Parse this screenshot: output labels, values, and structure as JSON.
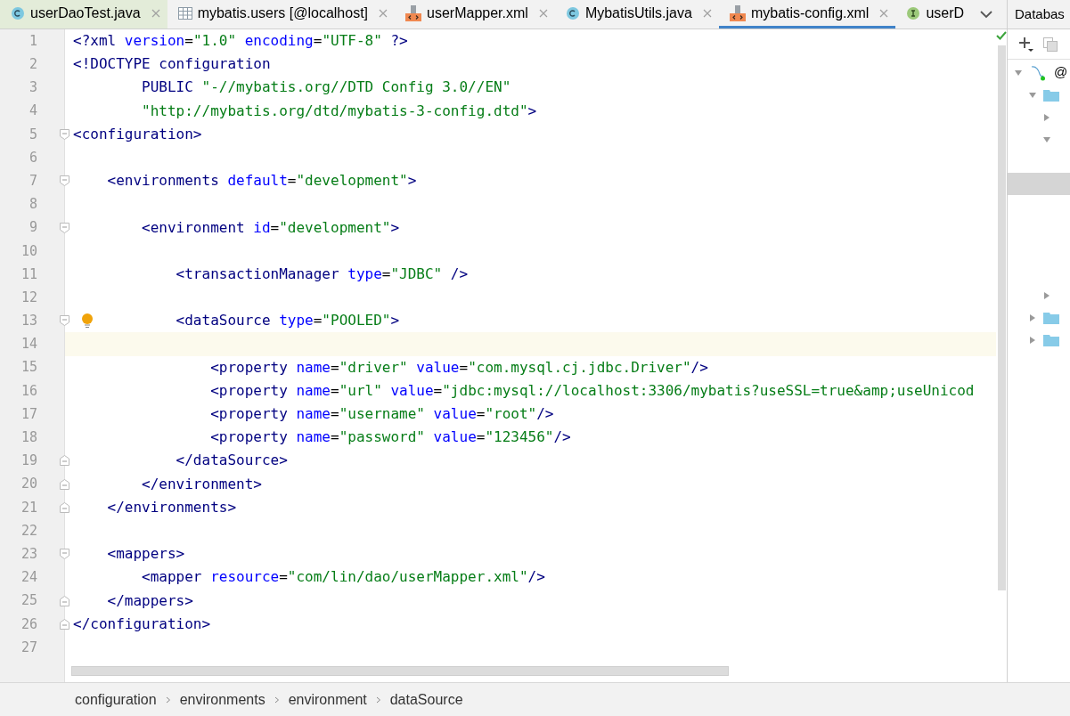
{
  "tabs": [
    {
      "kind": "class",
      "label": "userDaoTest.java",
      "selected": false,
      "closable": true,
      "color": "#e3ecd9"
    },
    {
      "kind": "table",
      "label": "mybatis.users [@localhost]",
      "selected": false,
      "closable": true,
      "color": "#f2f2f2"
    },
    {
      "kind": "xml",
      "label": "userMapper.xml",
      "selected": false,
      "closable": true,
      "color": "#f2f2f2"
    },
    {
      "kind": "class",
      "label": "MybatisUtils.java",
      "selected": false,
      "closable": true,
      "color": "#f2f2f2"
    },
    {
      "kind": "xml",
      "label": "mybatis-config.xml",
      "selected": true,
      "closable": true,
      "color": "#f2f2f2"
    },
    {
      "kind": "interface",
      "label": "userD",
      "selected": false,
      "closable": false,
      "color": "#f2f2f2"
    }
  ],
  "panel": {
    "title": "Databas",
    "tree": [
      {
        "kind": "connection",
        "label": "@",
        "expanded": true,
        "children": [
          {
            "kind": "folder",
            "expanded": true,
            "children": [
              {
                "kind": "node",
                "expanded": false
              },
              {
                "kind": "node",
                "expanded": true,
                "children": [
                  {
                    "kind": "row",
                    "selected": false
                  },
                  {
                    "kind": "row",
                    "selected": true
                  },
                  {
                    "kind": "row",
                    "selected": false
                  },
                  {
                    "kind": "row",
                    "selected": false
                  },
                  {
                    "kind": "row",
                    "selected": false
                  },
                  {
                    "kind": "row",
                    "selected": false
                  }
                ]
              },
              {
                "kind": "node",
                "expanded": false
              }
            ]
          },
          {
            "kind": "folder",
            "expanded": false
          },
          {
            "kind": "folder",
            "expanded": false
          }
        ]
      }
    ]
  },
  "editor": {
    "lines": [
      {
        "number": "1",
        "tokens": [
          {
            "kind": "tag",
            "text": "<?xml "
          },
          {
            "kind": "attr",
            "text": "version"
          },
          {
            "kind": "plain",
            "text": "="
          },
          {
            "kind": "value",
            "text": "\"1.0\" "
          },
          {
            "kind": "attr",
            "text": "encoding"
          },
          {
            "kind": "plain",
            "text": "="
          },
          {
            "kind": "value",
            "text": "\"UTF-8\" "
          },
          {
            "kind": "tag",
            "text": "?>"
          }
        ]
      },
      {
        "number": "2",
        "tokens": [
          {
            "kind": "tag",
            "text": "<!DOCTYPE configuration"
          }
        ]
      },
      {
        "number": "3",
        "tokens": [
          {
            "kind": "tag",
            "text": "        PUBLIC "
          },
          {
            "kind": "value",
            "text": "\"-//mybatis.org//DTD Config 3.0//EN\""
          }
        ]
      },
      {
        "number": "4",
        "tokens": [
          {
            "kind": "value",
            "text": "        \"http://mybatis.org/dtd/mybatis-3-config.dtd\""
          },
          {
            "kind": "tag",
            "text": ">"
          }
        ]
      },
      {
        "number": "5",
        "fold_open": true,
        "tokens": [
          {
            "kind": "tag",
            "text": "<configuration>"
          }
        ]
      },
      {
        "number": "6"
      },
      {
        "number": "7",
        "fold_open": true,
        "tokens": [
          {
            "kind": "tag",
            "text": "    <environments "
          },
          {
            "kind": "attr",
            "text": "default"
          },
          {
            "kind": "plain",
            "text": "="
          },
          {
            "kind": "value",
            "text": "\"development\""
          },
          {
            "kind": "tag",
            "text": ">"
          }
        ]
      },
      {
        "number": "8"
      },
      {
        "number": "9",
        "fold_open": true,
        "tokens": [
          {
            "kind": "tag",
            "text": "        <environment "
          },
          {
            "kind": "attr",
            "text": "id"
          },
          {
            "kind": "plain",
            "text": "="
          },
          {
            "kind": "value",
            "text": "\"development\""
          },
          {
            "kind": "tag",
            "text": ">"
          }
        ]
      },
      {
        "number": "10"
      },
      {
        "number": "11",
        "tokens": [
          {
            "kind": "tag",
            "text": "            <transactionManager "
          },
          {
            "kind": "attr",
            "text": "type"
          },
          {
            "kind": "plain",
            "text": "="
          },
          {
            "kind": "value",
            "text": "\"JDBC\" "
          },
          {
            "kind": "tag",
            "text": "/>"
          }
        ]
      },
      {
        "number": "12"
      },
      {
        "number": "13",
        "fold_open": true,
        "bulb": true,
        "tokens": [
          {
            "kind": "tag",
            "text": "            <dataSource "
          },
          {
            "kind": "attr",
            "text": "type"
          },
          {
            "kind": "plain",
            "text": "="
          },
          {
            "kind": "value",
            "text": "\"POOLED\""
          },
          {
            "kind": "tag",
            "text": ">"
          }
        ]
      },
      {
        "number": "14",
        "current": true
      },
      {
        "number": "15",
        "tokens": [
          {
            "kind": "tag",
            "text": "                <property "
          },
          {
            "kind": "attr",
            "text": "name"
          },
          {
            "kind": "plain",
            "text": "="
          },
          {
            "kind": "value",
            "text": "\"driver\" "
          },
          {
            "kind": "attr",
            "text": "value"
          },
          {
            "kind": "plain",
            "text": "="
          },
          {
            "kind": "value",
            "text": "\"com.mysql.cj.jdbc.Driver\""
          },
          {
            "kind": "tag",
            "text": "/>"
          }
        ]
      },
      {
        "number": "16",
        "tokens": [
          {
            "kind": "tag",
            "text": "                <property "
          },
          {
            "kind": "attr",
            "text": "name"
          },
          {
            "kind": "plain",
            "text": "="
          },
          {
            "kind": "value",
            "text": "\"url\" "
          },
          {
            "kind": "attr",
            "text": "value"
          },
          {
            "kind": "plain",
            "text": "="
          },
          {
            "kind": "value",
            "text": "\"jdbc:mysql://localhost:3306/mybatis?useSSL=true&amp;useUnicod"
          }
        ]
      },
      {
        "number": "17",
        "tokens": [
          {
            "kind": "tag",
            "text": "                <property "
          },
          {
            "kind": "attr",
            "text": "name"
          },
          {
            "kind": "plain",
            "text": "="
          },
          {
            "kind": "value",
            "text": "\"username\" "
          },
          {
            "kind": "attr",
            "text": "value"
          },
          {
            "kind": "plain",
            "text": "="
          },
          {
            "kind": "value",
            "text": "\"root\""
          },
          {
            "kind": "tag",
            "text": "/>"
          }
        ]
      },
      {
        "number": "18",
        "tokens": [
          {
            "kind": "tag",
            "text": "                <property "
          },
          {
            "kind": "attr",
            "text": "name"
          },
          {
            "kind": "plain",
            "text": "="
          },
          {
            "kind": "value",
            "text": "\"password\" "
          },
          {
            "kind": "attr",
            "text": "value"
          },
          {
            "kind": "plain",
            "text": "="
          },
          {
            "kind": "value",
            "text": "\"123456\""
          },
          {
            "kind": "tag",
            "text": "/>"
          }
        ]
      },
      {
        "number": "19",
        "fold_close": true,
        "tokens": [
          {
            "kind": "tag",
            "text": "            </dataSource>"
          }
        ]
      },
      {
        "number": "20",
        "fold_close": true,
        "tokens": [
          {
            "kind": "tag",
            "text": "        </environment>"
          }
        ]
      },
      {
        "number": "21",
        "fold_close": true,
        "tokens": [
          {
            "kind": "tag",
            "text": "    </environments>"
          }
        ]
      },
      {
        "number": "22"
      },
      {
        "number": "23",
        "fold_open": true,
        "tokens": [
          {
            "kind": "tag",
            "text": "    <mappers>"
          }
        ]
      },
      {
        "number": "24",
        "tokens": [
          {
            "kind": "tag",
            "text": "        <mapper "
          },
          {
            "kind": "attr",
            "text": "resource"
          },
          {
            "kind": "plain",
            "text": "="
          },
          {
            "kind": "value",
            "text": "\"com/lin/dao/userMapper.xml\""
          },
          {
            "kind": "tag",
            "text": "/>"
          }
        ]
      },
      {
        "number": "25",
        "fold_close": true,
        "tokens": [
          {
            "kind": "tag",
            "text": "    </mappers>"
          }
        ]
      },
      {
        "number": "26",
        "fold_close": true,
        "tokens": [
          {
            "kind": "tag",
            "text": "</configuration>"
          }
        ]
      },
      {
        "number": "27"
      }
    ]
  },
  "breadcrumbs": [
    "configuration",
    "environments",
    "environment",
    "dataSource"
  ]
}
